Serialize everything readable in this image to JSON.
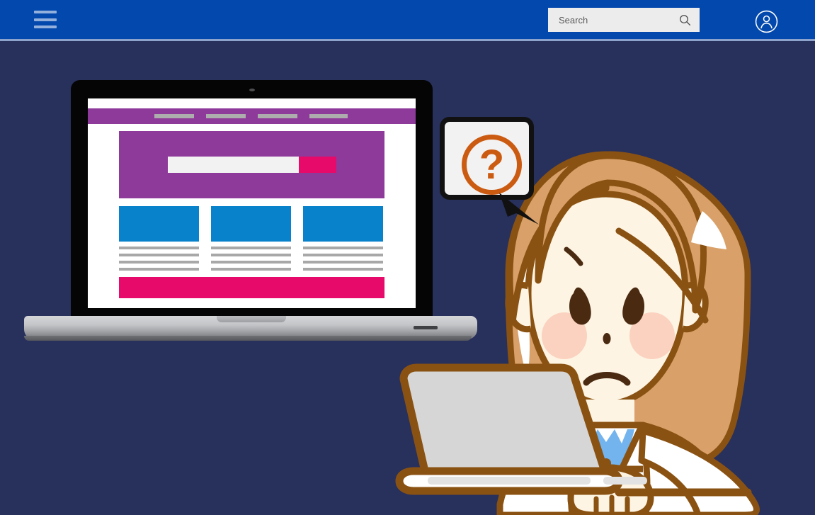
{
  "app": {
    "background_color": "#28305c",
    "header_color": "#0348ac"
  },
  "header": {
    "menu_icon": "hamburger-menu-icon",
    "search": {
      "placeholder": "Search",
      "value": "",
      "icon": "search-icon",
      "background_color": "#ececec"
    },
    "account": {
      "icon": "user-account-icon",
      "label": ""
    }
  },
  "illustration": {
    "description": "Confused woman at a laptop with a question mark speech bubble",
    "speech_bubble": {
      "symbol": "?",
      "symbol_color": "#cc5b12",
      "border_color": "#111111",
      "fill_color": "#f2f2f2"
    },
    "character": {
      "hair_color": "#d9a169",
      "hair_outline_color": "#8a5212",
      "skin_color": "#fdf4e3",
      "blush_color": "#fbd2bf",
      "eye_color": "#4a2a10",
      "jacket_color": "#ffffff",
      "shirt_color": "#73b4ef",
      "expression": "worried"
    },
    "front_laptop": {
      "screen_color": "#d6d6d6",
      "outline_color": "#8a5212"
    },
    "back_laptop": {
      "bezel_color": "#050505",
      "base_color": "#c3c5c8",
      "webcam": "webcam-dot"
    }
  },
  "mock_site": {
    "nav": {
      "background_color": "#8e3a9a",
      "items": [
        {
          "label": ""
        },
        {
          "label": ""
        },
        {
          "label": ""
        },
        {
          "label": ""
        }
      ]
    },
    "hero": {
      "background_color": "#8e3a9a",
      "search_value": "",
      "button_label": "",
      "button_color": "#e80a6a"
    },
    "cards": [
      {
        "image_color": "#0782cb",
        "lines": 4
      },
      {
        "image_color": "#0782cb",
        "lines": 4
      },
      {
        "image_color": "#0782cb",
        "lines": 4
      }
    ],
    "footer": {
      "background_color": "#e80a6a",
      "label": ""
    }
  }
}
